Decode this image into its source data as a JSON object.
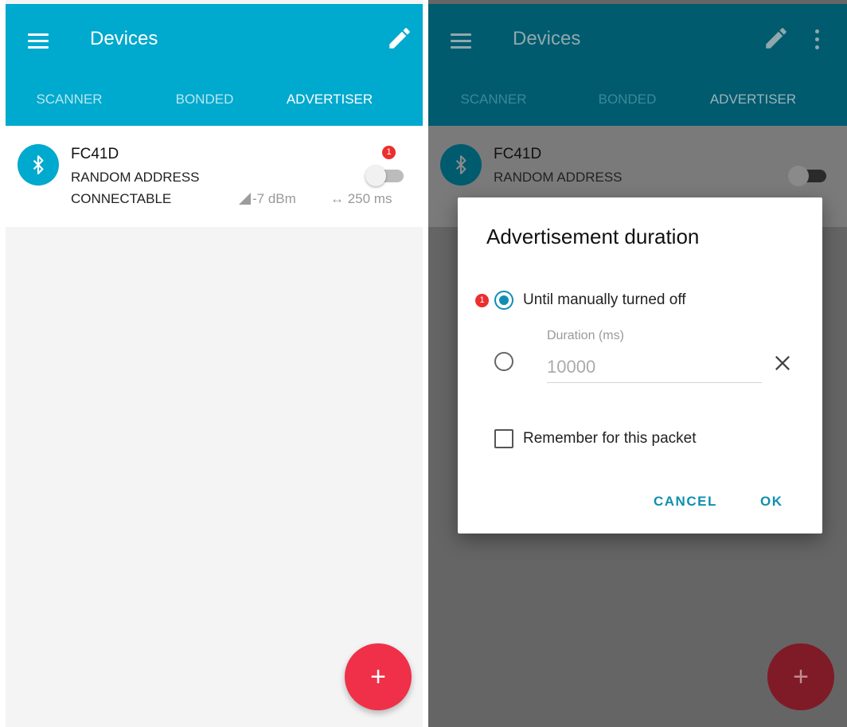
{
  "appbar": {
    "title": "Devices"
  },
  "tabs": [
    {
      "label": "SCANNER"
    },
    {
      "label": "BONDED"
    },
    {
      "label": "ADVERTISER"
    }
  ],
  "device": {
    "name": "FC41D",
    "address_type": "RANDOM ADDRESS",
    "connectable": "CONNECTABLE",
    "tx_power": "-7 dBm",
    "interval": "↔ 250 ms",
    "switch_on": false
  },
  "badges": {
    "switch": "1",
    "radio": "1"
  },
  "fab": {
    "label": "+"
  },
  "dialog": {
    "title": "Advertisement duration",
    "option_manual": "Until manually turned off",
    "duration_label": "Duration (ms)",
    "duration_placeholder": "10000",
    "remember_label": "Remember for this packet",
    "cancel": "CANCEL",
    "ok": "OK"
  },
  "colors": {
    "primary": "#00a9ce",
    "primary_dimmed": "#005b6f",
    "fab": "#ef3048",
    "accent_dialog": "#0f8fb0"
  }
}
